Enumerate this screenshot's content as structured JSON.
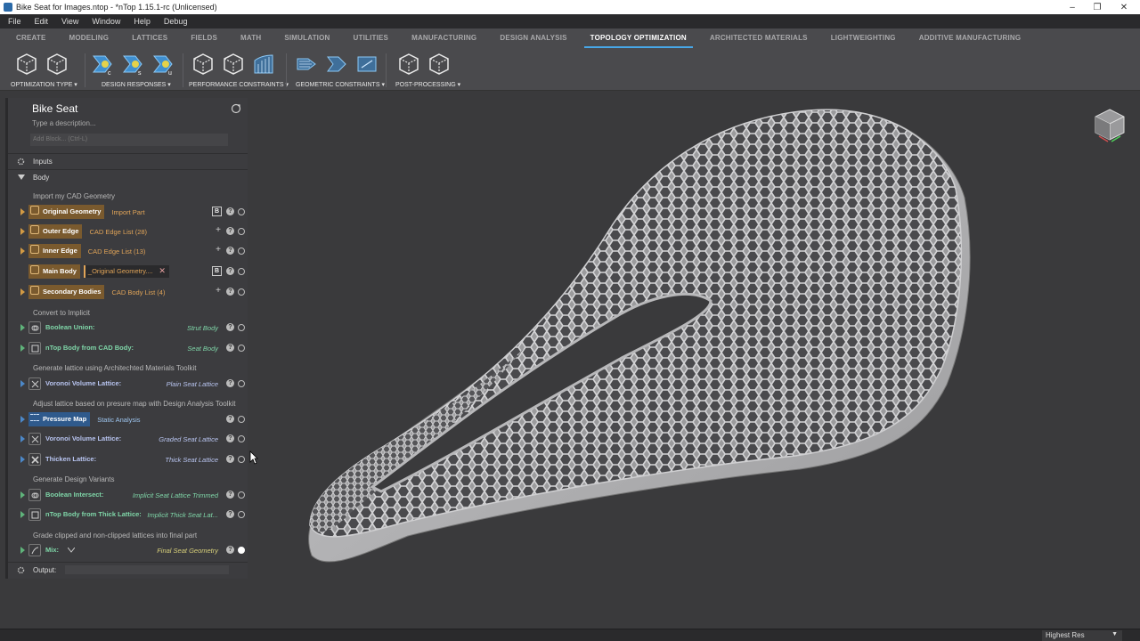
{
  "window": {
    "title": "Bike Seat for Images.ntop - *nTop 1.15.1-rc (Unlicensed)",
    "controls": [
      "–",
      "❐",
      "✕"
    ]
  },
  "menu": [
    "File",
    "Edit",
    "View",
    "Window",
    "Help",
    "Debug"
  ],
  "ribbon_tabs": [
    {
      "label": "CREATE"
    },
    {
      "label": "MODELING"
    },
    {
      "label": "LATTICES"
    },
    {
      "label": "FIELDS"
    },
    {
      "label": "MATH"
    },
    {
      "label": "SIMULATION"
    },
    {
      "label": "UTILITIES"
    },
    {
      "label": "MANUFACTURING"
    },
    {
      "label": "DESIGN ANALYSIS"
    },
    {
      "label": "TOPOLOGY OPTIMIZATION",
      "active": true
    },
    {
      "label": "ARCHITECTED MATERIALS"
    },
    {
      "label": "LIGHTWEIGHTING"
    },
    {
      "label": "ADDITIVE MANUFACTURING"
    }
  ],
  "ribbon_groups": [
    {
      "label": "OPTIMIZATION TYPE",
      "icons": [
        "cube-outline-icon",
        "cube-outline-icon"
      ]
    },
    {
      "label": "DESIGN RESPONSES",
      "icons": [
        "response-c-icon",
        "response-s-icon",
        "response-u-icon"
      ]
    },
    {
      "label": "PERFORMANCE CONSTRAINTS",
      "icons": [
        "cube-outline-icon",
        "cube-outline-icon",
        "stress-constraint-icon"
      ]
    },
    {
      "label": "GEOMETRIC CONSTRAINTS",
      "icons": [
        "overhang-icon",
        "symmetry-icon",
        "extrusion-icon"
      ]
    },
    {
      "label": "POST-PROCESSING",
      "icons": [
        "cube-outline-icon",
        "cube-outline-icon"
      ]
    }
  ],
  "notebook": {
    "title": "Bike Seat",
    "description_placeholder": "Type a description...",
    "add_block_placeholder": "Add Block... (Ctrl-L)",
    "sections": {
      "inputs": "Inputs",
      "body": "Body",
      "output": "Output:"
    },
    "comments": {
      "c1": "Import my CAD Geometry",
      "c2": "Convert to Implicit",
      "c3": "Generate lattice using Architechted Materials Toolkit",
      "c4": "Adjust lattice based on presure map with Design Analysis Toolkit",
      "c5": "Generate Design Variants",
      "c6": "Grade clipped and non-clipped lattices into final part"
    },
    "blocks": {
      "original_geometry": {
        "name": "Original Geometry",
        "value": "Import Part"
      },
      "outer_edge": {
        "name": "Outer Edge",
        "value": "CAD Edge List (28)"
      },
      "inner_edge": {
        "name": "Inner Edge",
        "value": "CAD Edge List (13)"
      },
      "main_body": {
        "name": "Main Body",
        "value": "_Original Geometry...."
      },
      "secondary_bodies": {
        "name": "Secondary Bodies",
        "value": "CAD Body List (4)"
      },
      "boolean_union": {
        "name": "Boolean Union:",
        "value": "Strut Body"
      },
      "ntop_body_cad": {
        "name": "nTop Body from CAD Body:",
        "value": "Seat Body"
      },
      "voronoi_1": {
        "name": "Voronoi Volume Lattice:",
        "value": "Plain Seat Lattice"
      },
      "pressure_map": {
        "name": "Pressure Map",
        "value": "Static Analysis"
      },
      "voronoi_2": {
        "name": "Voronoi Volume Lattice:",
        "value": "Graded Seat Lattice"
      },
      "thicken": {
        "name": "Thicken Lattice:",
        "value": "Thick Seat Lattice"
      },
      "boolean_intersect": {
        "name": "Boolean Intersect:",
        "value": "Implicit Seat Lattice Trimmed"
      },
      "ntop_body_thick": {
        "name": "nTop Body from Thick Lattice:",
        "value": "Implicit Thick Seat Lat..."
      },
      "mix": {
        "name": "Mix:",
        "value": "Final Seat Geometry"
      }
    },
    "b_label": "B",
    "q_label": "?"
  },
  "status": {
    "render_quality": "Highest Res"
  },
  "colors": {
    "accent": "#47a7e8",
    "orange_block": "#7a5a2e",
    "green_text": "#7fd6a8"
  }
}
